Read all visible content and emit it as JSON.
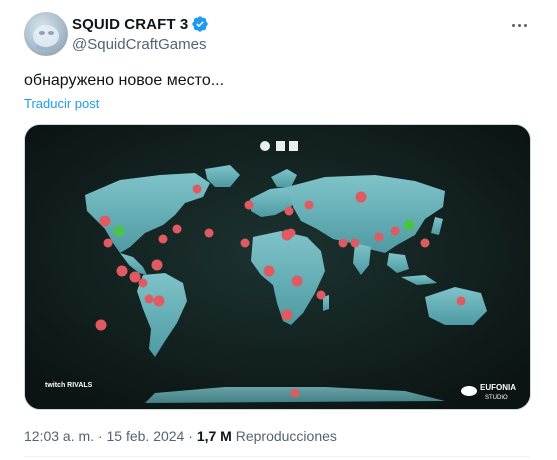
{
  "author": {
    "display_name": "SQUID CRAFT 3",
    "handle": "@SquidCraftGames",
    "verified": true
  },
  "post": {
    "text": "обнаружено новое место...",
    "translate_label": "Traducir post"
  },
  "media": {
    "top_icons": [
      "info-icon",
      "castle-icon",
      "creeper-icon"
    ],
    "logo_left": "twitch RIVALS",
    "logo_right_1": "EUFONIA",
    "logo_right_2": "STUDIO",
    "marker_colors": {
      "default": "#e05a62",
      "highlight": "#4cc24a"
    }
  },
  "meta": {
    "time": "12:03 a. m.",
    "sep1": "·",
    "date": "15 feb. 2024",
    "sep2": "·",
    "views_count": "1,7 M",
    "views_label": "Reproducciones"
  }
}
